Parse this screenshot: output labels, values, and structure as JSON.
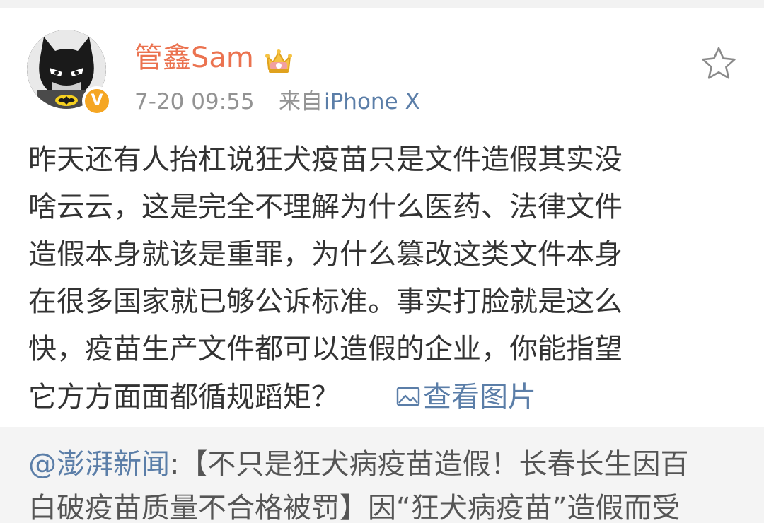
{
  "post": {
    "author": {
      "name": "管鑫Sam",
      "verified_badge": "V",
      "badge_color": "#f5a623",
      "name_color": "#eb7350"
    },
    "meta": {
      "timestamp": "7-20 09:55",
      "source_prefix": "来自",
      "source_device": "iPhone X"
    },
    "actions": {
      "favorite_icon": "star-outline-icon"
    },
    "body_lines": [
      "昨天还有人抬杠说狂犬疫苗只是文件造假其实没",
      "啥云云，这是完全不理解为什么医药、法律文件",
      "造假本身就该是重罪，为什么篡改这类文件本身",
      "在很多国家就已够公诉标准。事实打脸就是这么",
      "快，疫苗生产文件都可以造假的企业，你能指望",
      "它方方面面都循规蹈矩？"
    ],
    "view_image_label": "查看图片",
    "link_color": "#5b7ea8"
  },
  "repost": {
    "author": "@澎湃新闻",
    "separator": ":",
    "line1_text": "【不只是狂犬病疫苗造假！长春长生因百",
    "line2_text": "白破疫苗质量不合格被罚】因“狂犬病疫苗”造假而受"
  }
}
